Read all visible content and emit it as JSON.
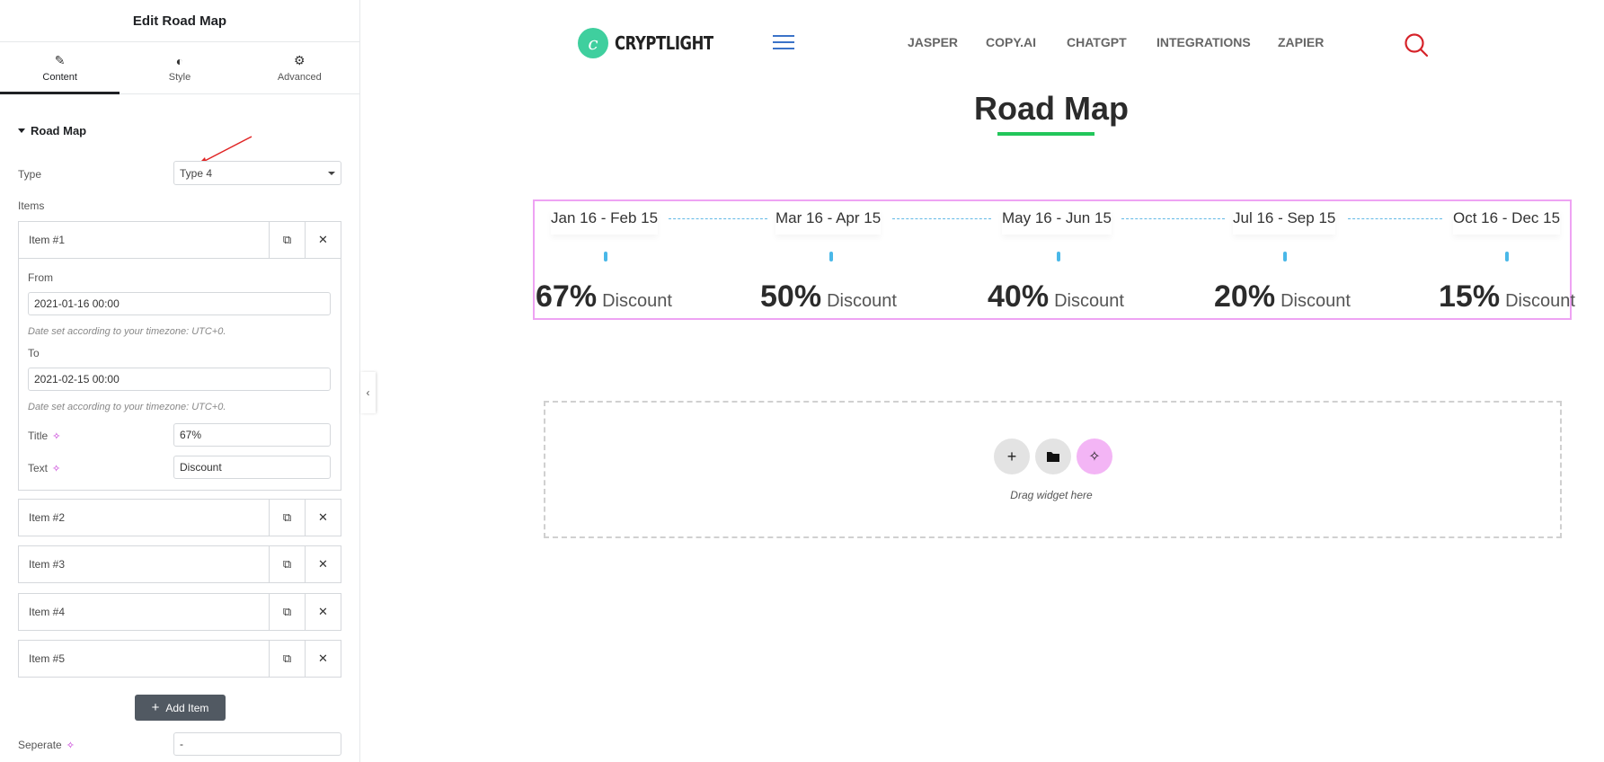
{
  "panel": {
    "title": "Edit Road Map",
    "tabs": [
      {
        "label": "Content",
        "icon": "pencil-icon"
      },
      {
        "label": "Style",
        "icon": "contrast-icon"
      },
      {
        "label": "Advanced",
        "icon": "gear-icon"
      }
    ],
    "section_title": "Road Map",
    "type_label": "Type",
    "type_value": "Type 4",
    "items_label": "Items",
    "items": [
      {
        "label": "Item #1"
      },
      {
        "label": "Item #2"
      },
      {
        "label": "Item #3"
      },
      {
        "label": "Item #4"
      },
      {
        "label": "Item #5"
      }
    ],
    "item1": {
      "from_label": "From",
      "from_value": "2021-01-16 00:00",
      "from_note": "Date set according to your timezone: UTC+0.",
      "to_label": "To",
      "to_value": "2021-02-15 00:00",
      "to_note": "Date set according to your timezone: UTC+0.",
      "title_label": "Title",
      "title_value": "67%",
      "text_label": "Text",
      "text_value": "Discount"
    },
    "add_item_label": "Add Item",
    "separate_label": "Seperate",
    "separate_value": "-"
  },
  "site": {
    "logo_text": "CRYPTLIGHT",
    "logo_letter": "c",
    "nav": [
      "JASPER",
      "COPY.AI",
      "CHATGPT",
      "INTEGRATIONS",
      "ZAPIER"
    ],
    "heading": "Road Map",
    "roadmap": [
      {
        "date": "Jan 16 - Feb 15",
        "value": "67%",
        "text": "Discount"
      },
      {
        "date": "Mar 16 - Apr 15",
        "value": "50%",
        "text": "Discount"
      },
      {
        "date": "May 16 - Jun 15",
        "value": "40%",
        "text": "Discount"
      },
      {
        "date": "Jul 16 - Sep 15",
        "value": "20%",
        "text": "Discount"
      },
      {
        "date": "Oct 16 - Dec 15",
        "value": "15%",
        "text": "Discount"
      }
    ],
    "drop_text": "Drag widget here"
  },
  "colors": {
    "accent_green": "#22c65a",
    "logo_green": "#3fcf9e",
    "selection_pink": "#eea3f3",
    "timeline_blue": "#4ab8e8",
    "search_red": "#d6232a"
  }
}
